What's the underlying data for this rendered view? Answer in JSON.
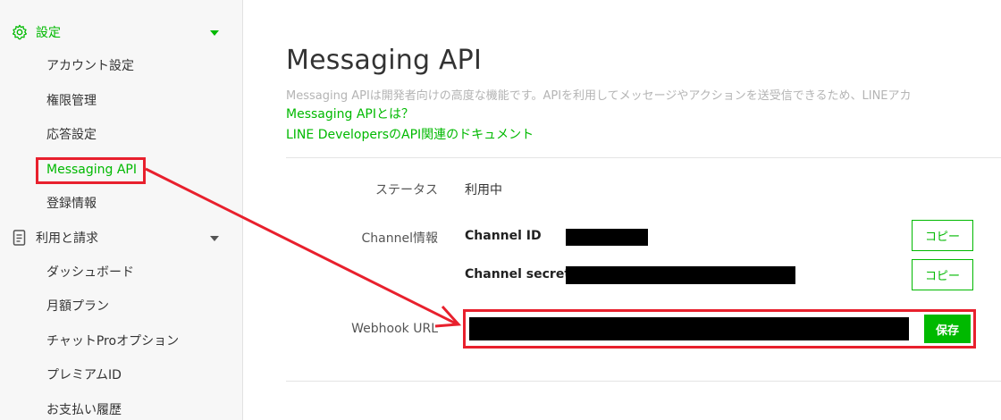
{
  "sidebar": {
    "sections": [
      {
        "label": "設定",
        "icon": "gear-icon",
        "expanded": true,
        "active": true
      },
      {
        "label": "利用と請求",
        "icon": "document-icon",
        "expanded": true,
        "active": false
      }
    ],
    "settings_items": [
      {
        "label": "アカウント設定"
      },
      {
        "label": "権限管理"
      },
      {
        "label": "応答設定"
      },
      {
        "label": "Messaging API",
        "active": true
      },
      {
        "label": "登録情報"
      }
    ],
    "billing_items": [
      {
        "label": "ダッシュボード"
      },
      {
        "label": "月額プラン"
      },
      {
        "label": "チャットProオプション"
      },
      {
        "label": "プレミアムID"
      },
      {
        "label": "お支払い履歴"
      }
    ]
  },
  "main": {
    "title": "Messaging API",
    "description": "Messaging APIは開発者向けの高度な機能です。APIを利用してメッセージやアクションを送受信できるため、LINEアカ",
    "links": [
      "Messaging APIとは？",
      "LINE DevelopersのAPI関連のドキュメント"
    ],
    "status_label": "ステータス",
    "status_value": "利用中",
    "channel_label": "Channel情報",
    "channel_id_label": "Channel ID",
    "channel_secret_label": "Channel secret",
    "copy_label": "コピー",
    "webhook_label": "Webhook URL",
    "save_label": "保存"
  },
  "colors": {
    "accent": "#00b900",
    "highlight": "#e8202d",
    "redaction": "#000000"
  }
}
